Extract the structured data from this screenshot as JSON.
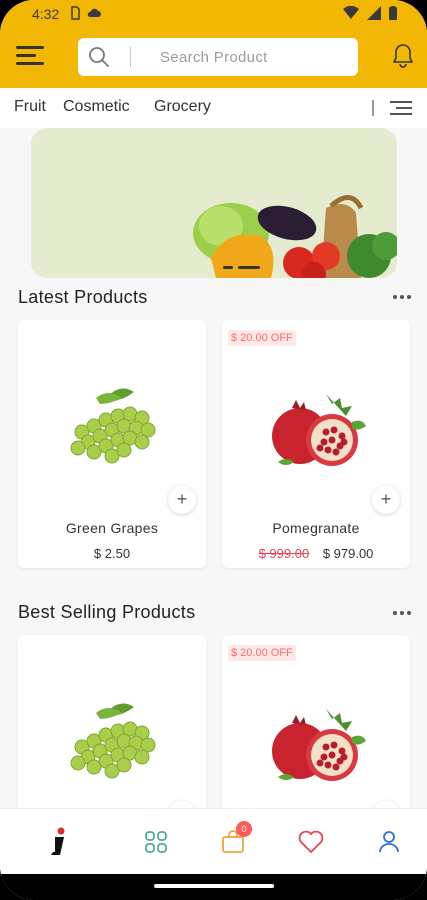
{
  "status_bar": {
    "time": "4:32"
  },
  "header": {
    "search_placeholder": "Search Product"
  },
  "categories": [
    "Fruit",
    "Cosmetic",
    "Grocery"
  ],
  "sections": [
    {
      "title": "Latest Products",
      "products": [
        {
          "name": "Green Grapes",
          "price": "$ 2.50",
          "old_price": "",
          "badge": ""
        },
        {
          "name": "Pomegranate",
          "price": "$ 979.00",
          "old_price": "$ 999.00",
          "badge": "$ 20.00 OFF"
        }
      ]
    },
    {
      "title": "Best Selling Products",
      "products": [
        {
          "name": "Green Grapes",
          "badge": ""
        },
        {
          "name": "Pomegranate",
          "badge": "$ 20.00 OFF"
        }
      ]
    }
  ],
  "bottom_nav": {
    "items": [
      "home-logo-icon",
      "categories-grid-icon",
      "cart-bag-icon",
      "wishlist-heart-icon",
      "profile-user-icon"
    ],
    "cart_count": "0"
  },
  "colors": {
    "brand_yellow": "#f2b705",
    "discount_red": "#ff6b6b",
    "grid_teal": "#4caf8a",
    "cart_orange": "#f2a33a",
    "heart_red": "#e4455a",
    "profile_blue": "#2f6fd6"
  }
}
